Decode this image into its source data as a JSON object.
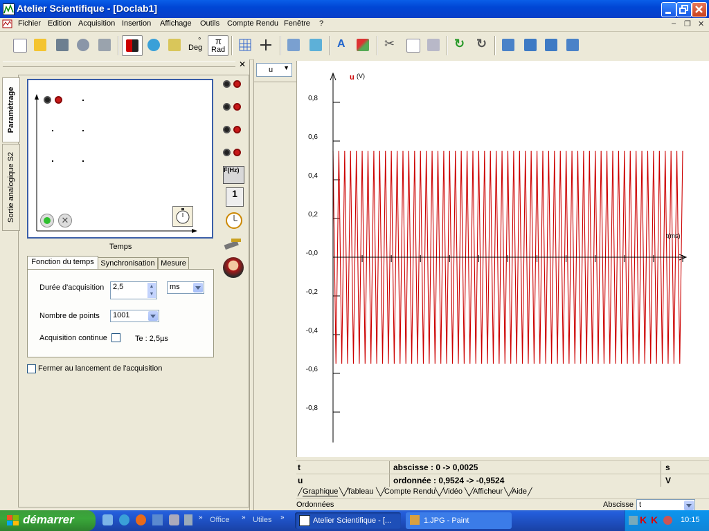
{
  "window": {
    "title": "Atelier Scientifique - [Doclab1]"
  },
  "menubar": {
    "items": [
      "Fichier",
      "Edition",
      "Acquisition",
      "Insertion",
      "Affichage",
      "Outils",
      "Compte Rendu",
      "Fenêtre",
      "?"
    ]
  },
  "toolbar": {
    "deg_label": "Deg",
    "rad_label": "Rad",
    "pi_label": "π"
  },
  "left_panel": {
    "vtabs": [
      "Paramètrage",
      "Sortie analogique S2"
    ],
    "schematic_caption": "Temps",
    "tabs": [
      "Fonction du temps",
      "Synchronisation",
      "Mesure"
    ],
    "duration_label": "Durée d'acquisition",
    "duration_value": "2,5",
    "duration_unit": "ms",
    "points_label": "Nombre de points",
    "points_value": "1001",
    "continuous_label": "Acquisition continue",
    "te_label": "Te : 2,5µs",
    "close_on_launch_label": "Fermer au lancement de l'acquisition",
    "side_icons": {
      "freq": "F(Hz)",
      "counter": "1"
    }
  },
  "graph": {
    "variable_select": "u",
    "y_axis_label": "u",
    "y_unit": "(V)",
    "x_axis_label": "t(ms)"
  },
  "chart_data": {
    "type": "line",
    "series": [
      {
        "name": "u",
        "color": "#cc0000",
        "amplitude": 0.55,
        "cycles": 60
      }
    ],
    "y_ticks": [
      "0,8",
      "0,6",
      "0,4",
      "0,2",
      "-0,0",
      "-0,2",
      "-0,4",
      "-0,6",
      "-0,8"
    ],
    "ylim": [
      -0.95,
      0.95
    ],
    "xlim": [
      0,
      2.5
    ],
    "xlabel": "t(ms)",
    "ylabel": "u (V)"
  },
  "info": {
    "x_var": "t",
    "x_range": "abscisse : 0 -> 0,0025",
    "x_unit": "s",
    "y_var": "u",
    "y_range": "ordonnée : 0,9524 -> -0,9524",
    "y_unit": "V"
  },
  "bottom_tabs": [
    "Graphique",
    "Tableau",
    "Compte Rendu",
    "Vidéo",
    "Afficheur",
    "Aide"
  ],
  "ordonnees_label": "Ordonnées",
  "abscisse_label": "Abscisse",
  "abscisse_value": "t",
  "taskbar": {
    "start_label": "démarrer",
    "quicklaunch_office": "Office",
    "quicklaunch_utiles": "Utiles",
    "task_atelier": "Atelier Scientifique - [...",
    "task_paint": "1.JPG - Paint",
    "clock": "10:15"
  },
  "colors": {
    "accent": "#0a5ee8",
    "signal": "#cc0000",
    "panel_bg": "#ece9d8"
  }
}
